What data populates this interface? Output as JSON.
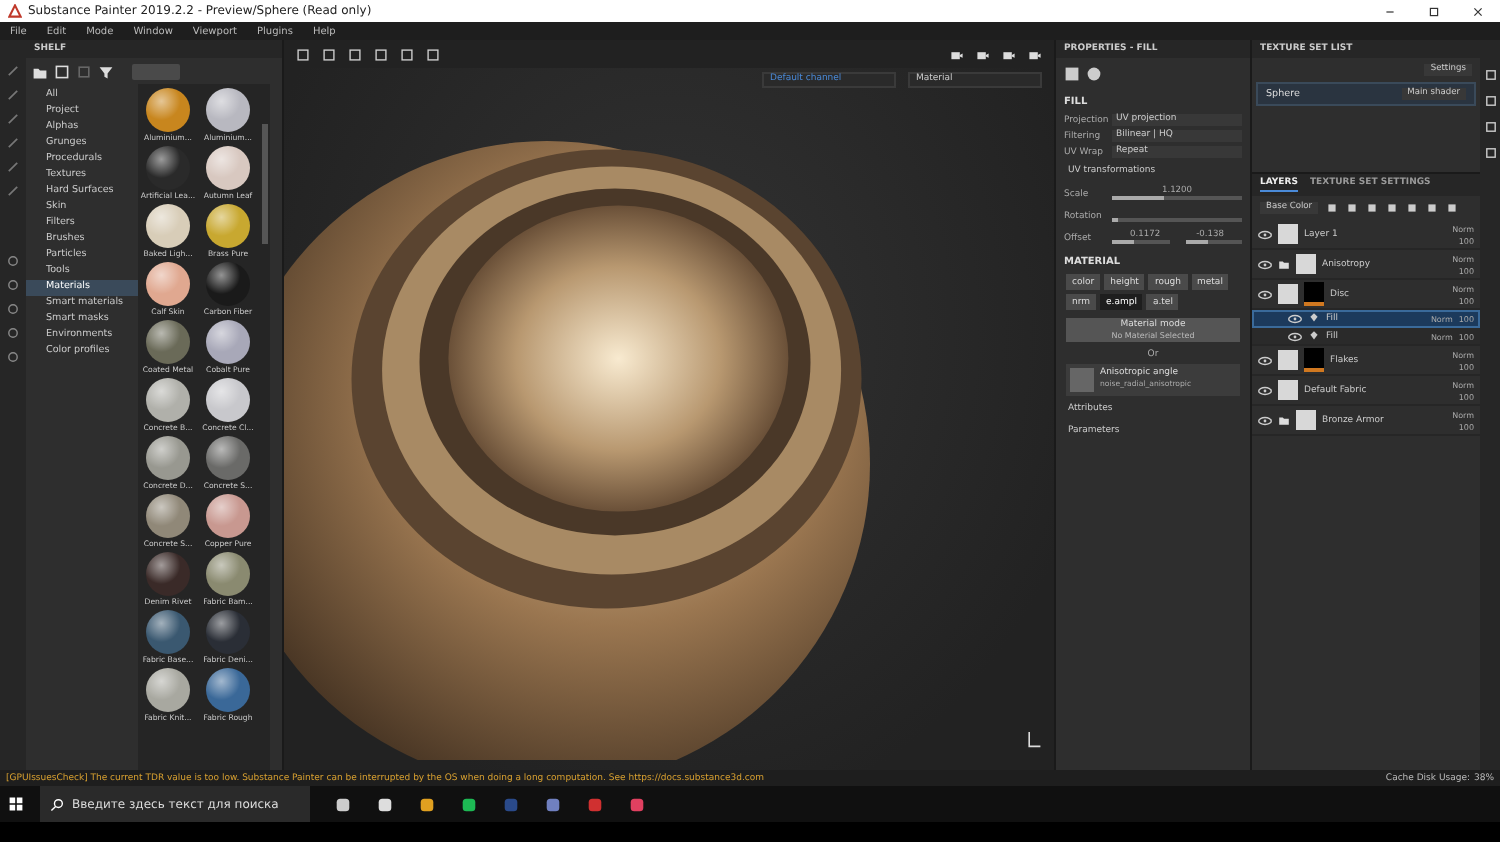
{
  "window": {
    "title": "Substance Painter 2019.2.2 - Preview/Sphere (Read only)"
  },
  "menu": [
    "File",
    "Edit",
    "Mode",
    "Window",
    "Viewport",
    "Plugins",
    "Help"
  ],
  "shelf": {
    "title": "SHELF",
    "categories": [
      {
        "label": "All",
        "selected": false
      },
      {
        "label": "Project",
        "selected": false
      },
      {
        "label": "Alphas",
        "selected": false
      },
      {
        "label": "Grunges",
        "selected": false
      },
      {
        "label": "Procedurals",
        "selected": false
      },
      {
        "label": "Textures",
        "selected": false
      },
      {
        "label": "Hard Surfaces",
        "selected": false
      },
      {
        "label": "Skin",
        "selected": false
      },
      {
        "label": "Filters",
        "selected": false
      },
      {
        "label": "Brushes",
        "selected": false
      },
      {
        "label": "Particles",
        "selected": false
      },
      {
        "label": "Tools",
        "selected": false
      },
      {
        "label": "Materials",
        "selected": true
      },
      {
        "label": "Smart materials",
        "selected": false
      },
      {
        "label": "Smart masks",
        "selected": false
      },
      {
        "label": "Environments",
        "selected": false
      },
      {
        "label": "Color profiles",
        "selected": false
      }
    ],
    "materials": [
      {
        "name": "Aluminium...",
        "color": "#c8861e"
      },
      {
        "name": "Aluminium...",
        "color": "#b8b8c0"
      },
      {
        "name": "Artificial Lea...",
        "color": "#2a2a2a"
      },
      {
        "name": "Autumn Leaf",
        "color": "#d8c8c0"
      },
      {
        "name": "Baked Ligh...",
        "color": "#d8cdb8"
      },
      {
        "name": "Brass Pure",
        "color": "#c8a830"
      },
      {
        "name": "Calf Skin",
        "color": "#e0a890"
      },
      {
        "name": "Carbon Fiber",
        "color": "#1a1a1a"
      },
      {
        "name": "Coated Metal",
        "color": "#6a6a58"
      },
      {
        "name": "Cobalt Pure",
        "color": "#a8a8b8"
      },
      {
        "name": "Concrete B...",
        "color": "#b0b0aa"
      },
      {
        "name": "Concrete Cl...",
        "color": "#c8c8cc"
      },
      {
        "name": "Concrete D...",
        "color": "#989890"
      },
      {
        "name": "Concrete S...",
        "color": "#6a6a68"
      },
      {
        "name": "Concrete S...",
        "color": "#908878"
      },
      {
        "name": "Copper Pure",
        "color": "#c89890"
      },
      {
        "name": "Denim Rivet",
        "color": "#3a2a28"
      },
      {
        "name": "Fabric Bam...",
        "color": "#8a8a70"
      },
      {
        "name": "Fabric Base...",
        "color": "#3a5870"
      },
      {
        "name": "Fabric Deni...",
        "color": "#2a2e36"
      },
      {
        "name": "Fabric Knit...",
        "color": "#a8a8a0"
      },
      {
        "name": "Fabric Rough",
        "color": "#3a6898"
      }
    ]
  },
  "viewport": {
    "channel": "Default channel",
    "mode": "Material"
  },
  "properties": {
    "title": "PROPERTIES - FILL",
    "section": "FILL",
    "fields": [
      {
        "label": "Projection",
        "value": "UV projection"
      },
      {
        "label": "Filtering",
        "value": "Bilinear | HQ"
      },
      {
        "label": "UV Wrap",
        "value": "Repeat"
      }
    ],
    "uv_title": "UV transformations",
    "sliders": [
      {
        "label": "Scale",
        "readings": [
          "1.1200"
        ],
        "levels": [
          {
            "level": 0.4
          }
        ]
      },
      {
        "label": "Rotation",
        "levels": [
          {
            "level": 0.05
          }
        ]
      },
      {
        "label": "Offset",
        "readings": [
          "0.1172",
          "-0.138"
        ],
        "levels": [
          {
            "level": 0.4
          },
          {
            "level": 0.4
          }
        ]
      }
    ],
    "material_title": "MATERIAL",
    "channels": [
      {
        "label": "color",
        "selected": false
      },
      {
        "label": "height",
        "selected": false
      },
      {
        "label": "rough",
        "selected": false
      },
      {
        "label": "metal",
        "selected": false
      },
      {
        "label": "nrm",
        "selected": false
      },
      {
        "label": "e.ampl",
        "selected": true
      },
      {
        "label": "a.tel",
        "selected": false
      }
    ],
    "material_mode": {
      "title": "Material mode",
      "value": "No Material Selected"
    },
    "or": "Or",
    "resource": {
      "title": "Anisotropic angle",
      "value": "noise_radial_anisotropic"
    },
    "sections": [
      "Attributes",
      "Parameters"
    ]
  },
  "texture_set_list": {
    "title": "TEXTURE SET LIST",
    "settings": "Settings",
    "sets": [
      {
        "name": "Sphere",
        "shader": "Main shader"
      }
    ]
  },
  "layers": {
    "tabs": [
      {
        "label": "LAYERS",
        "selected": true
      },
      {
        "label": "TEXTURE SET SETTINGS",
        "selected": false
      }
    ],
    "channel": "Base Color",
    "items": [
      {
        "name": "Layer 1",
        "kind": "layer",
        "mask": false,
        "blend": "Norm",
        "opacity": "100",
        "selected": false
      },
      {
        "name": "Anisotropy",
        "kind": "folder",
        "mask": false,
        "blend": "Norm",
        "opacity": "100",
        "selected": false
      },
      {
        "name": "Disc",
        "kind": "layer",
        "mask": true,
        "blend": "Norm",
        "opacity": "100",
        "selected": false,
        "children": [
          {
            "name": "Fill",
            "kind": "fill",
            "mask": false,
            "blend": "Norm",
            "opacity": "100",
            "selected": true
          },
          {
            "name": "Fill",
            "kind": "fill",
            "mask": false,
            "blend": "Norm",
            "opacity": "100",
            "selected": false
          }
        ]
      },
      {
        "name": "Flakes",
        "kind": "layer",
        "mask": true,
        "blend": "Norm",
        "opacity": "100",
        "selected": false
      },
      {
        "name": "Default Fabric",
        "kind": "layer",
        "mask": false,
        "blend": "Norm",
        "opacity": "100",
        "selected": false
      },
      {
        "name": "Bronze Armor",
        "kind": "folder",
        "mask": false,
        "blend": "Norm",
        "opacity": "100",
        "selected": false
      }
    ]
  },
  "status": {
    "message": "[GPUIssuesCheck] The current TDR value is too low. Substance Painter can be interrupted by the OS when doing a long computation. See https://docs.substance3d.com",
    "cache": "Cache Disk Usage:",
    "cache_value": "38%"
  },
  "taskbar": {
    "search_placeholder": "Введите здесь текст для поиска"
  }
}
